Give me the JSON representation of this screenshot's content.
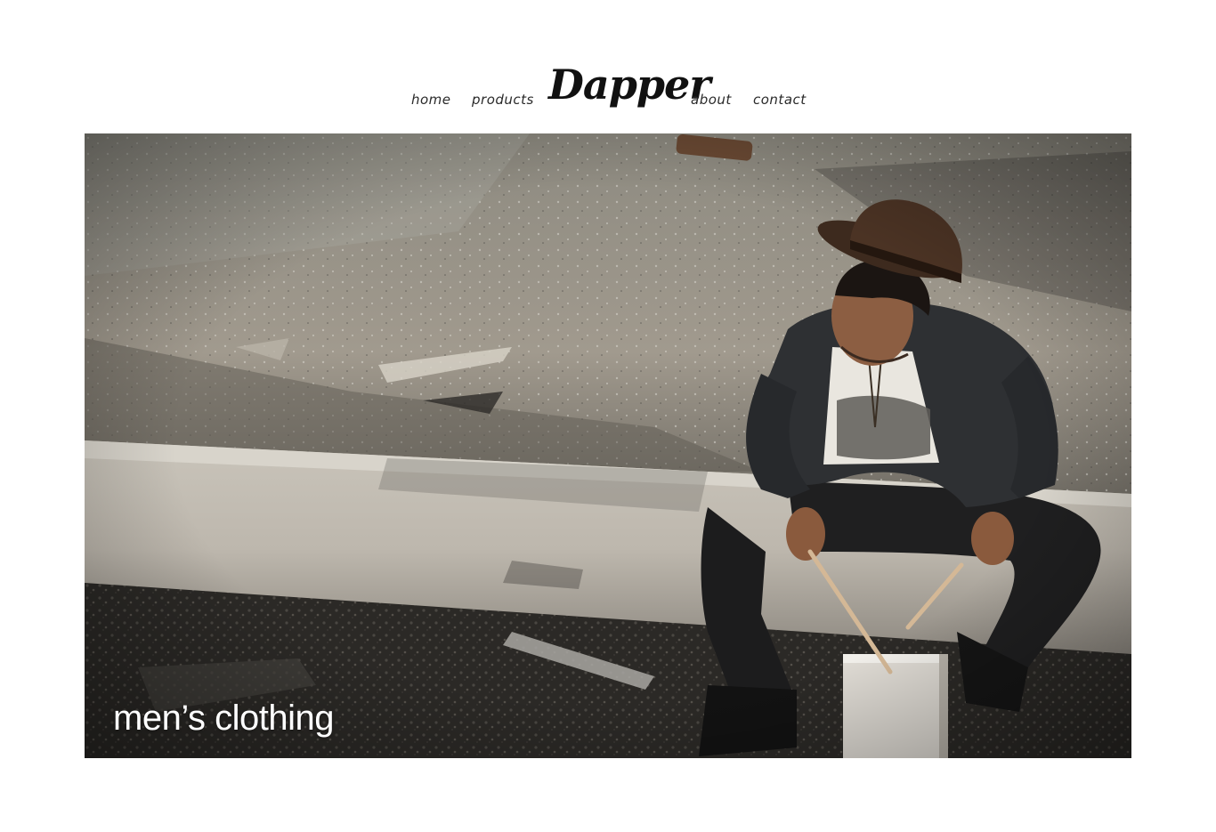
{
  "brand": {
    "logo_text": "Dapper"
  },
  "nav": {
    "items": [
      {
        "label": "home"
      },
      {
        "label": "products"
      },
      {
        "label": "about"
      },
      {
        "label": "contact"
      }
    ]
  },
  "hero": {
    "caption": "men’s clothing",
    "image_subject": "man-in-hat-sitting-on-ledge-with-drumsticks"
  },
  "colors": {
    "background": "#ffffff",
    "text": "#111111",
    "caption": "#ffffff"
  }
}
